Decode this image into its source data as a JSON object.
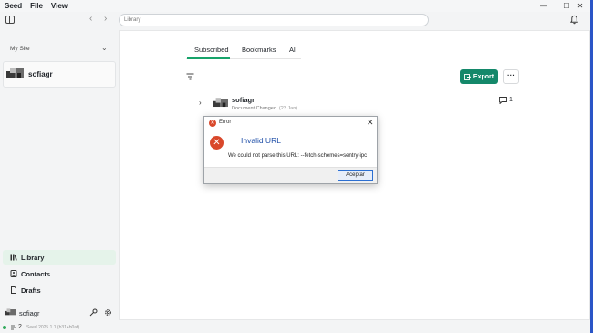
{
  "menubar": {
    "items": [
      "Seed",
      "File",
      "View"
    ]
  },
  "window_controls": {
    "minimize": "—",
    "maximize": "☐",
    "close": "✕"
  },
  "toolbar": {
    "search_placeholder": "Library",
    "back": "‹",
    "forward": "›"
  },
  "sidebar": {
    "site_header": "My Site",
    "site_chevron": "⌄",
    "account_name": "sofiagr",
    "nav": [
      {
        "label": "Library",
        "active": true
      },
      {
        "label": "Contacts",
        "active": false
      },
      {
        "label": "Drafts",
        "active": false
      }
    ],
    "footer_user": "sofiagr"
  },
  "status": {
    "peers": "2",
    "version": "Seed 2025.1.1 (b314b0af)"
  },
  "main": {
    "tabs": [
      {
        "label": "Subscribed",
        "active": true
      },
      {
        "label": "Bookmarks",
        "active": false
      },
      {
        "label": "All",
        "active": false
      }
    ],
    "export_label": "Export",
    "more_label": "···",
    "document": {
      "chevron": "›",
      "title": "sofiagr",
      "status": "Document Changed",
      "date": "(23 Jan)",
      "comment_count": "1"
    }
  },
  "dialog": {
    "title": "Error",
    "close": "✕",
    "heading": "Invalid URL",
    "message": "We could not parse this URL: --fetch-schemes=sentry-ipc",
    "ok_label": "Aceptar"
  },
  "colors": {
    "accent": "#14886a",
    "error": "#d9482b",
    "link_blue": "#1f4fa8"
  }
}
